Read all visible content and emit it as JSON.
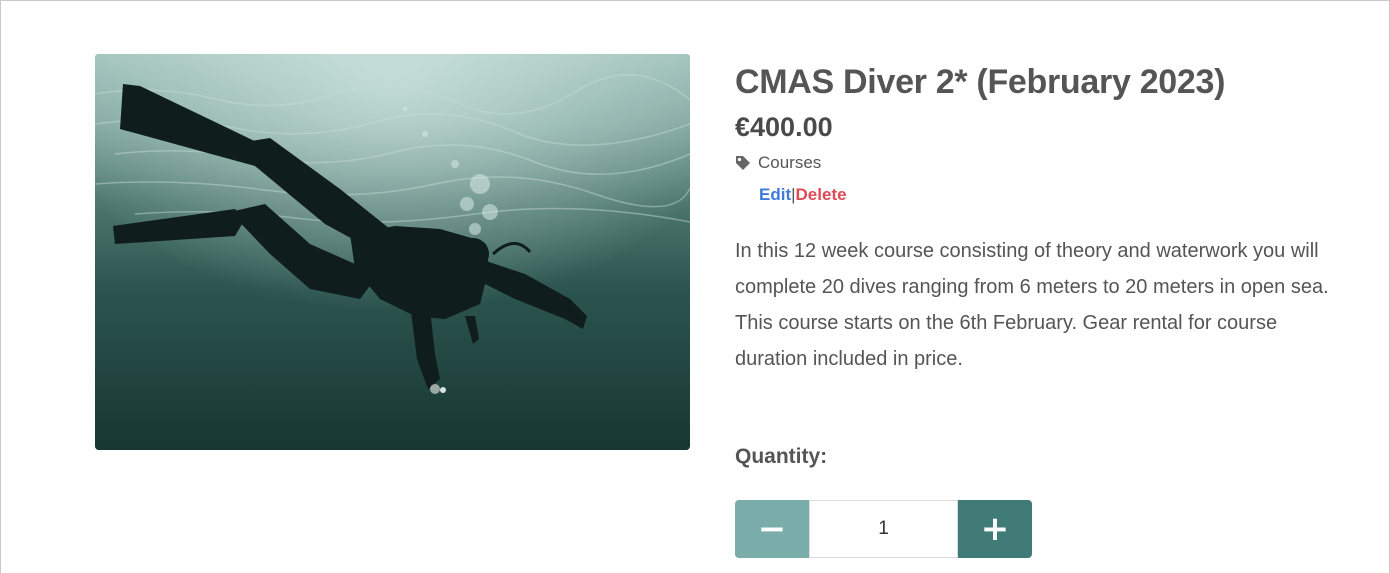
{
  "product": {
    "title": "CMAS Diver 2* (February 2023)",
    "price": "€400.00",
    "category": "Courses",
    "edit_label": "Edit",
    "separator": "|",
    "delete_label": "Delete",
    "description": "In this 12 week course consisting of theory and waterwork you will complete 20 dives ranging from 6 meters to 20 meters in open sea. This course starts on the 6th February. Gear rental for course duration included in price.",
    "image_alt": "Scuba diver swimming underwater"
  },
  "quantity": {
    "label": "Quantity:",
    "value": "1",
    "minus_symbol": "−",
    "plus_symbol": "+"
  },
  "icons": {
    "category": "tag-icon"
  },
  "colors": {
    "edit": "#3d7bd9",
    "delete": "#e04a55",
    "minus_button": "#7aacaa",
    "plus_button": "#417b78"
  }
}
